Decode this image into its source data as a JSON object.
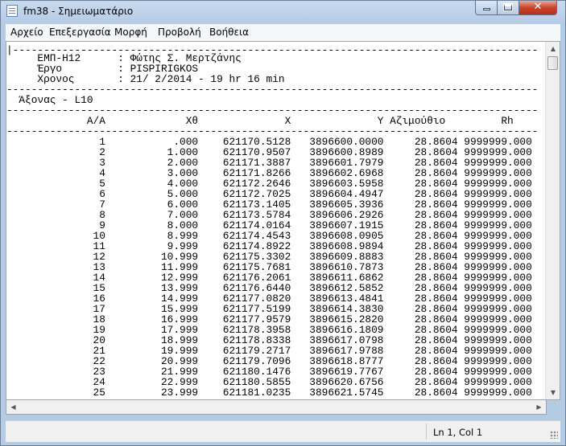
{
  "window": {
    "title": "fm38 - Σημειωματάριο"
  },
  "menu": [
    "Αρχείο",
    "Επεξεργασία",
    "Μορφή",
    "Προβολή",
    "Βοήθεια"
  ],
  "document": {
    "lines": [
      "|-------------------------------------------------------------------------------------",
      "     ΕΜΠ-Η12      : Φώτης Σ. Μερτζάνης",
      "     Έργο         : PISPIRIGKOS",
      "     Χρονος       : 21/ 2/2014 - 19 hr 16 min",
      "--------------------------------------------------------------------------------------",
      "  Άξονας - L10",
      "--------------------------------------------------------------------------------------",
      "             A/A             Xθ              X              Y Αζιμούθιο         Rh",
      "--------------------------------------------------------------------------------------",
      "",
      "               1           .000    621170.5128   3896600.0000     28.8604 9999999.000",
      "               2          1.000    621170.9507   3896600.8989     28.8604 9999999.000",
      "               3          2.000    621171.3887   3896601.7979     28.8604 9999999.000",
      "               4          3.000    621171.8266   3896602.6968     28.8604 9999999.000",
      "               5          4.000    621172.2646   3896603.5958     28.8604 9999999.000",
      "               6          5.000    621172.7025   3896604.4947     28.8604 9999999.000",
      "               7          6.000    621173.1405   3896605.3936     28.8604 9999999.000",
      "               8          7.000    621173.5784   3896606.2926     28.8604 9999999.000",
      "               9          8.000    621174.0164   3896607.1915     28.8604 9999999.000",
      "              10          8.999    621174.4543   3896608.0905     28.8604 9999999.000",
      "              11          9.999    621174.8922   3896608.9894     28.8604 9999999.000",
      "              12         10.999    621175.3302   3896609.8883     28.8604 9999999.000",
      "              13         11.999    621175.7681   3896610.7873     28.8604 9999999.000",
      "              14         12.999    621176.2061   3896611.6862     28.8604 9999999.000",
      "              15         13.999    621176.6440   3896612.5852     28.8604 9999999.000",
      "              16         14.999    621177.0820   3896613.4841     28.8604 9999999.000",
      "              17         15.999    621177.5199   3896614.3830     28.8604 9999999.000",
      "              18         16.999    621177.9579   3896615.2820     28.8604 9999999.000",
      "              19         17.999    621178.3958   3896616.1809     28.8604 9999999.000",
      "              20         18.999    621178.8338   3896617.0798     28.8604 9999999.000",
      "              21         19.999    621179.2717   3896617.9788     28.8604 9999999.000",
      "              22         20.999    621179.7096   3896618.8777     28.8604 9999999.000",
      "              23         21.999    621180.1476   3896619.7767     28.8604 9999999.000",
      "              24         22.999    621180.5855   3896620.6756     28.8604 9999999.000",
      "              25         23.999    621181.0235   3896621.5745     28.8604 9999999.000"
    ]
  },
  "status": {
    "position": "Ln 1, Col 1"
  }
}
